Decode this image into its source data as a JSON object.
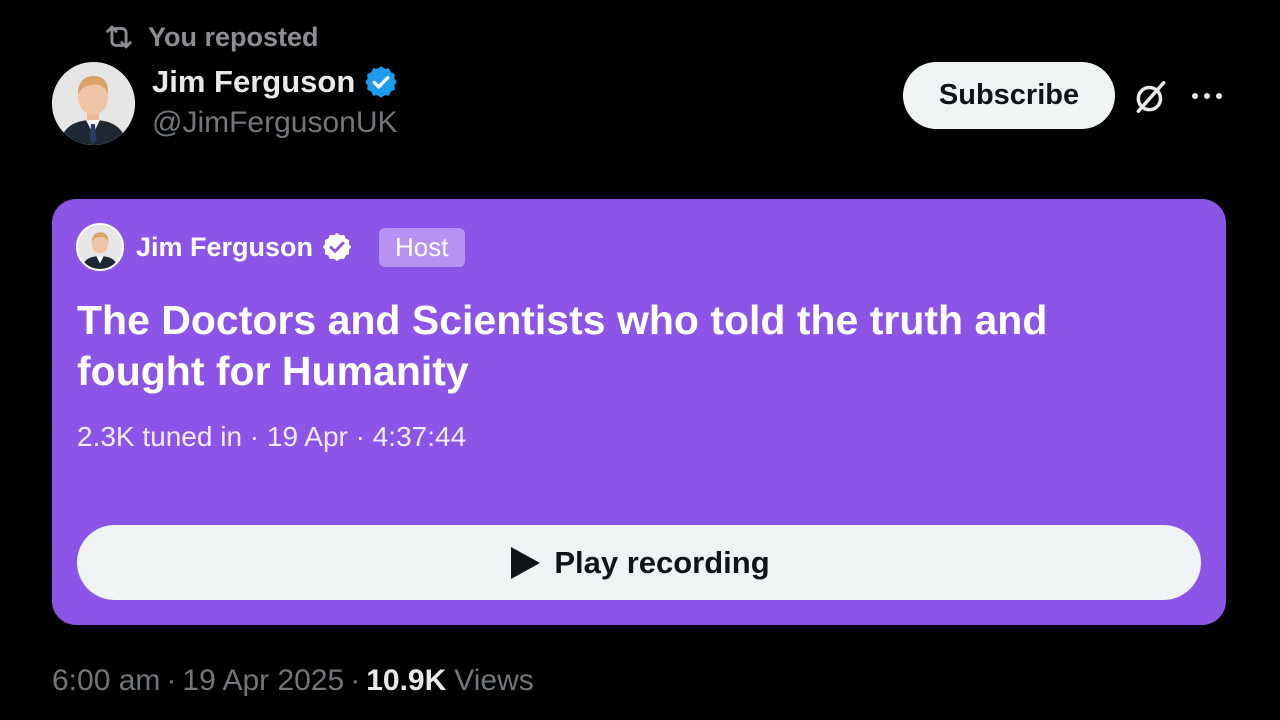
{
  "repost": {
    "text": "You reposted",
    "icon": "repost-icon"
  },
  "author": {
    "name": "Jim Ferguson",
    "handle": "@JimFergusonUK",
    "verified": true,
    "avatar": "avatar-photo"
  },
  "actions": {
    "subscribe_label": "Subscribe",
    "grok_icon": "grok-icon",
    "more_icon": "more-icon"
  },
  "space": {
    "host_name": "Jim Ferguson",
    "host_badge": "Host",
    "title": "The Doctors and Scientists who told the truth and fought for Humanity",
    "meta": "2.3K tuned in · 19 Apr · 4:37:44",
    "play_label": "Play recording",
    "card_color": "#8c55e8"
  },
  "footer": {
    "time": "6:00 am",
    "date": "19 Apr 2025",
    "views_count": "10.9K",
    "views_label": "Views",
    "separator": "·"
  },
  "colors": {
    "background": "#000000",
    "verified": "#1d9bf0",
    "muted": "#71767b"
  }
}
